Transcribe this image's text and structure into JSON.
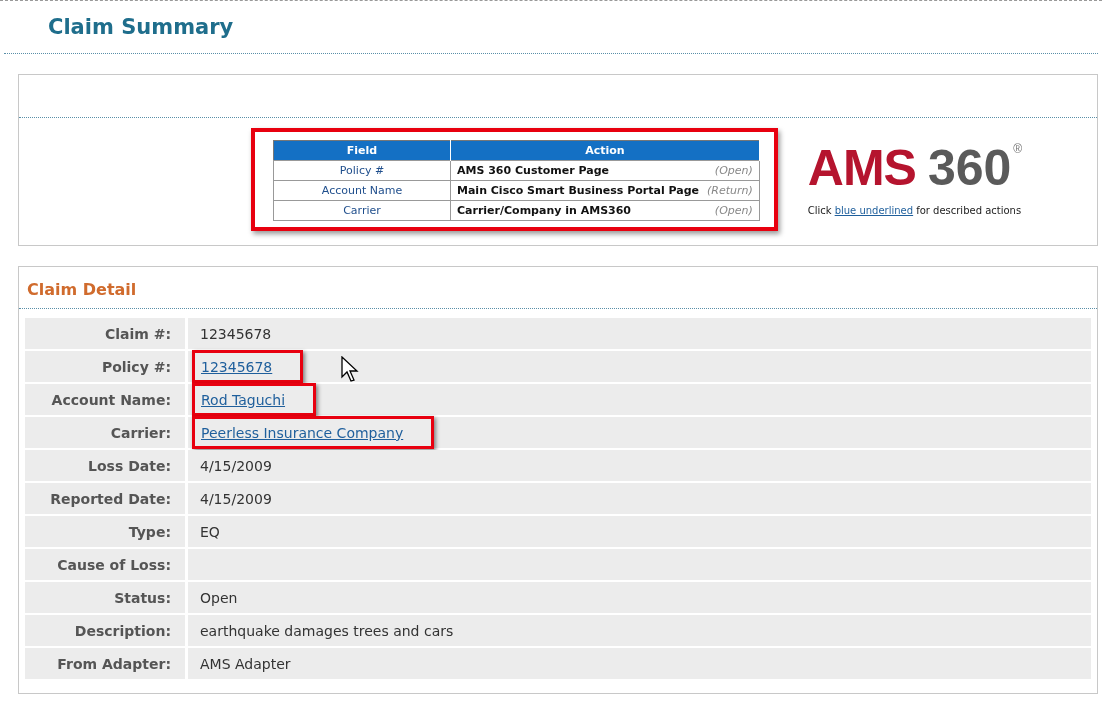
{
  "page_title": "Claim Summary",
  "legend": {
    "highlighted": true,
    "columns": [
      "Field",
      "Action"
    ],
    "rows": [
      {
        "field": "Policy #",
        "action": "AMS 360 Customer Page",
        "note": "(Open)"
      },
      {
        "field": "Account Name",
        "action": "Main Cisco Smart Business Portal Page",
        "note": "(Return)"
      },
      {
        "field": "Carrier",
        "action": "Carrier/Company in AMS360",
        "note": "(Open)"
      }
    ]
  },
  "logo": {
    "word": "AMS",
    "number": "360",
    "mark": "®"
  },
  "hint": {
    "before": "Click",
    "link": "blue underlined",
    "after": "for described actions"
  },
  "claim_detail": {
    "title": "Claim Detail",
    "rows": [
      {
        "label": "Claim #:",
        "value": "12345678",
        "kind": "text",
        "highlighted": false
      },
      {
        "label": "Policy #:",
        "value": "12345678",
        "kind": "link",
        "highlighted": true
      },
      {
        "label": "Account Name:",
        "value": "Rod Taguchi",
        "kind": "link",
        "highlighted": true
      },
      {
        "label": "Carrier:",
        "value": "Peerless Insurance Company",
        "kind": "link",
        "highlighted": true
      },
      {
        "label": "Loss Date:",
        "value": "4/15/2009",
        "kind": "text",
        "highlighted": false
      },
      {
        "label": "Reported Date:",
        "value": "4/15/2009",
        "kind": "text",
        "highlighted": false
      },
      {
        "label": "Type:",
        "value": "EQ",
        "kind": "text",
        "highlighted": false
      },
      {
        "label": "Cause of Loss:",
        "highlighted": false
      },
      {
        "label": "Status:",
        "value": "Open",
        "kind": "text",
        "highlighted": false
      },
      {
        "label": "Description:",
        "value": "earthquake damages trees and cars",
        "kind": "text",
        "highlighted": false
      },
      {
        "label": "From Adapter:",
        "value": "AMS Adapter",
        "kind": "text",
        "highlighted": false
      }
    ]
  }
}
